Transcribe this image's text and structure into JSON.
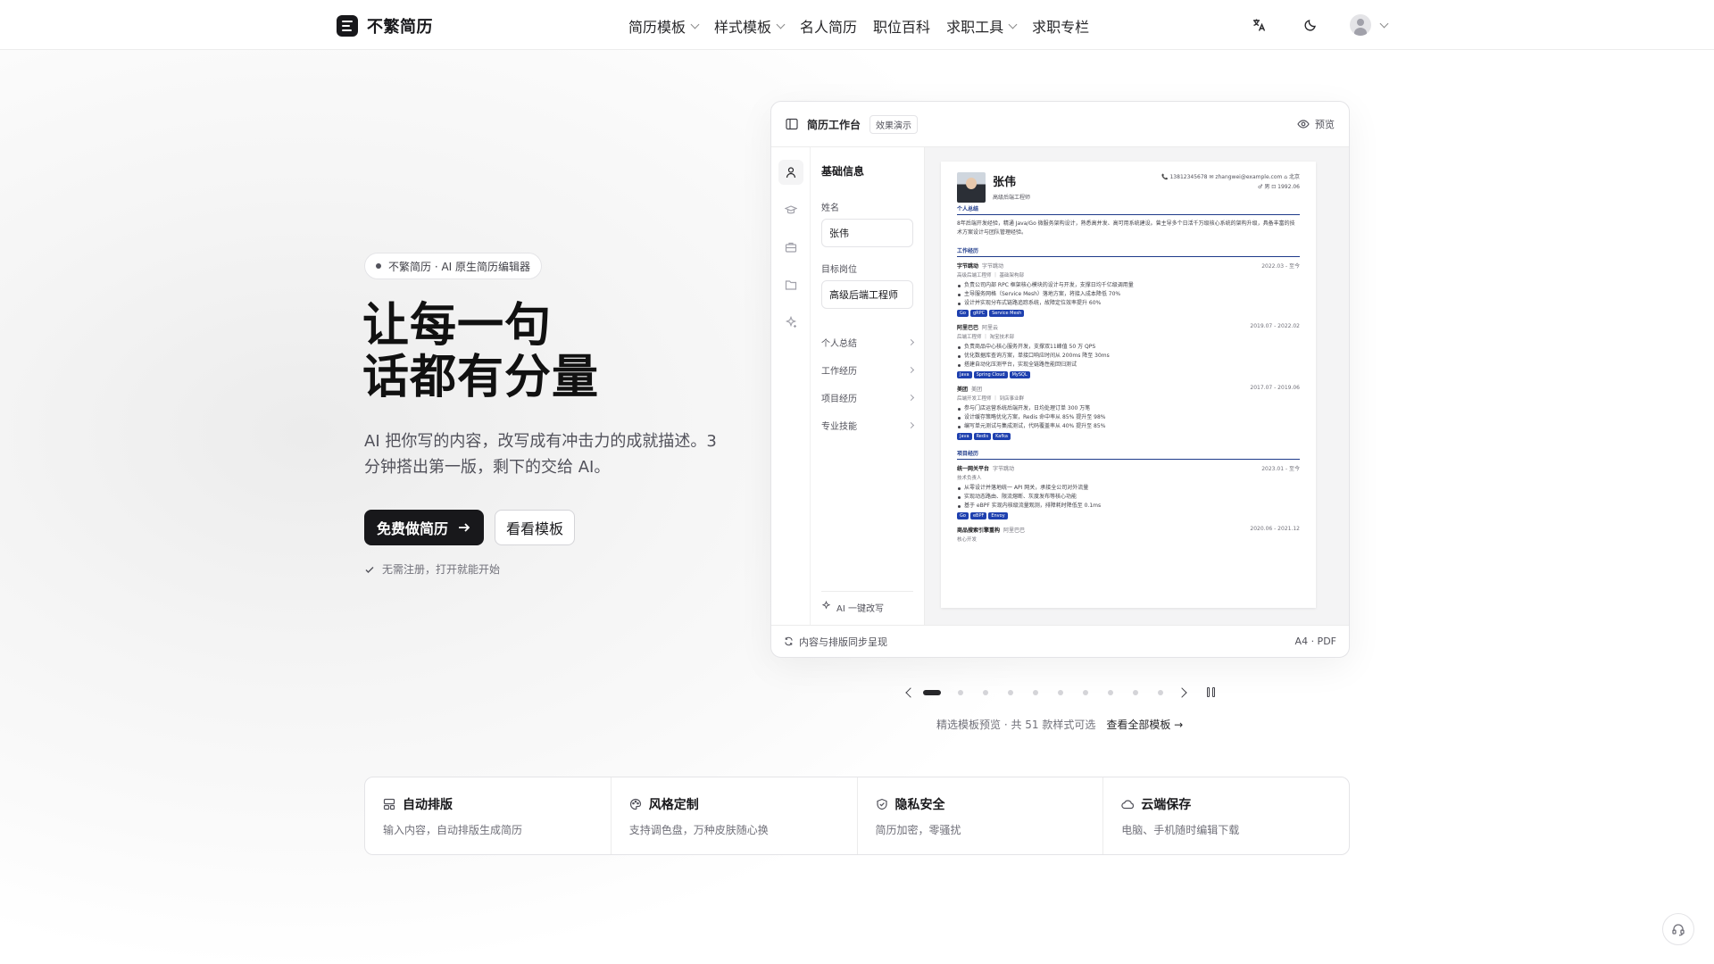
{
  "brand": {
    "name": "不繁简历"
  },
  "nav": {
    "items": [
      {
        "label": "简历模板",
        "dropdown": true
      },
      {
        "label": "样式模板",
        "dropdown": true
      },
      {
        "label": "名人简历",
        "dropdown": false
      },
      {
        "label": "职位百科",
        "dropdown": false
      },
      {
        "label": "求职工具",
        "dropdown": true
      },
      {
        "label": "求职专栏",
        "dropdown": false
      }
    ],
    "right_icons": [
      "translate-icon",
      "moon-icon",
      "avatar"
    ]
  },
  "hero": {
    "pill": "不繁简历 · AI 原生简历编辑器",
    "headline_1": "让每一句",
    "headline_2": "话都有分量",
    "subtitle": "AI 把你写的内容，改写成有冲击力的成就描述。3 分钟搭出第一版，剩下的交给 AI。",
    "cta_primary": "免费做简历",
    "cta_secondary": "看看模板",
    "note": "无需注册，打开就能开始"
  },
  "mock": {
    "title": "简历工作台",
    "tag": "效果演示",
    "preview": "预览",
    "form": {
      "heading": "基础信息",
      "name_label": "姓名",
      "name_value": "张伟",
      "target_label": "目标岗位",
      "target_value": "高级后端工程师",
      "sections": [
        "个人总结",
        "工作经历",
        "项目经历",
        "专业技能"
      ],
      "ai_button": "AI 一键改写"
    },
    "footer_left": "内容与排版同步呈现",
    "footer_right": "A4 · PDF",
    "resume": {
      "name": "张伟",
      "role": "高级后端工程师",
      "contact_line1": "📞 13812345678  ✉ zhangwei@example.com  ⌂ 北京",
      "contact_line2": "♂ 男  ⊡ 1992.06",
      "summary_title": "个人总结",
      "summary": "8年后端开发经验，精通 Java/Go 微服务架构设计，熟悉高并发、高可用系统建设。曾主导多个日活千万级核心系统的架构升级，具备丰富的技术方案设计与团队管理经验。",
      "work_title": "工作经历",
      "jobs": [
        {
          "company": "字节跳动",
          "dept": "字节跳动",
          "date": "2022.03 - 至今",
          "role": "高级后端工程师 ｜ 基础架构部",
          "bullets": [
            "负责公司内部 RPC 框架核心模块的设计与开发，支撑日均千亿级调用量",
            "主导服务网格（Service Mesh）落地方案，将接入成本降低 70%",
            "设计并实现分布式链路追踪系统，故障定位效率提升 60%"
          ],
          "chips": [
            "Go",
            "gRPC",
            "Service Mesh"
          ]
        },
        {
          "company": "阿里巴巴",
          "dept": "阿里云",
          "date": "2019.07 - 2022.02",
          "role": "后端工程师 ｜ 淘宝技术部",
          "bullets": [
            "负责商品中心核心服务开发，支撑双11峰值 50 万 QPS",
            "优化数据库查询方案，单接口响应时间从 200ms 降至 30ms",
            "搭建自动化压测平台，实现全链路性能回归测试"
          ],
          "chips": [
            "Java",
            "Spring Cloud",
            "MySQL"
          ]
        },
        {
          "company": "美团",
          "dept": "美团",
          "date": "2017.07 - 2019.06",
          "role": "后端开发工程师 ｜ 到店事业群",
          "bullets": [
            "参与门店运营系统后端开发，日均处理订单 300 万笔",
            "设计缓存策略优化方案，Redis 命中率从 85% 提升至 98%",
            "编写单元测试与集成测试，代码覆盖率从 40% 提升至 85%"
          ],
          "chips": [
            "Java",
            "Redis",
            "Kafka"
          ]
        }
      ],
      "project_title": "项目经历",
      "projects": [
        {
          "company": "统一网关平台",
          "dept": "字节跳动",
          "date": "2023.01 - 至今",
          "role": "技术负责人",
          "bullets": [
            "从零设计并落地统一 API 网关，承接全公司对外流量",
            "实现动态路由、限流熔断、灰度发布等核心功能",
            "基于 eBPF 实现内核级流量观测，排障耗时降低至 0.1ms"
          ],
          "chips": [
            "Go",
            "eBPF",
            "Envoy"
          ]
        },
        {
          "company": "商品搜索引擎重构",
          "dept": "阿里巴巴",
          "date": "2020.06 - 2021.12",
          "role": "核心开发",
          "bullets": [],
          "chips": []
        }
      ]
    }
  },
  "carousel": {
    "slides": 10,
    "active": 0
  },
  "gallery_note": {
    "text": "精选模板预览 · 共 51 款样式可选",
    "link": "查看全部模板 →"
  },
  "features": [
    {
      "icon": "layout-icon",
      "title": "自动排版",
      "desc": "输入内容，自动排版生成简历"
    },
    {
      "icon": "palette-icon",
      "title": "风格定制",
      "desc": "支持调色盘，万种皮肤随心换"
    },
    {
      "icon": "shield-icon",
      "title": "隐私安全",
      "desc": "简历加密，零骚扰"
    },
    {
      "icon": "cloud-icon",
      "title": "云端保存",
      "desc": "电脑、手机随时编辑下载"
    }
  ],
  "colors": {
    "primary": "#18181b",
    "accent_blue": "#1e3a8a",
    "chip_blue": "#1e40af"
  }
}
